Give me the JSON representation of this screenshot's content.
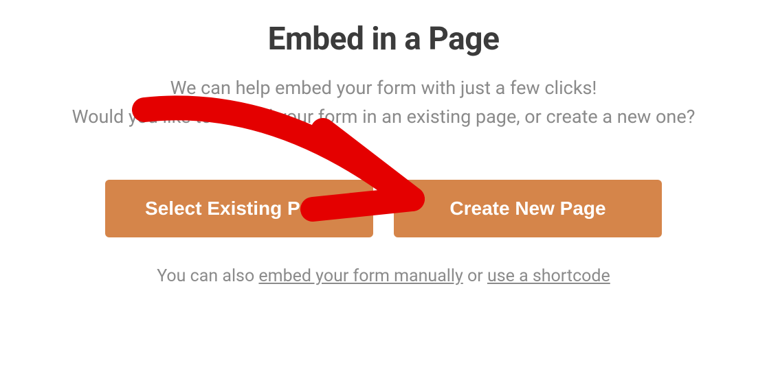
{
  "heading": "Embed in a Page",
  "description_line1": "We can help embed your form with just a few clicks!",
  "description_line2": "Would you like to embed your form in an existing page, or create a new one?",
  "buttons": {
    "select_existing": "Select Existing Page",
    "create_new": "Create New Page"
  },
  "footnote": {
    "prefix": "You can also ",
    "link_manual": "embed your form manually",
    "middle": " or ",
    "link_shortcode": "use a shortcode"
  },
  "annotation": {
    "target": "create-new-page-button",
    "color": "#e40000"
  }
}
